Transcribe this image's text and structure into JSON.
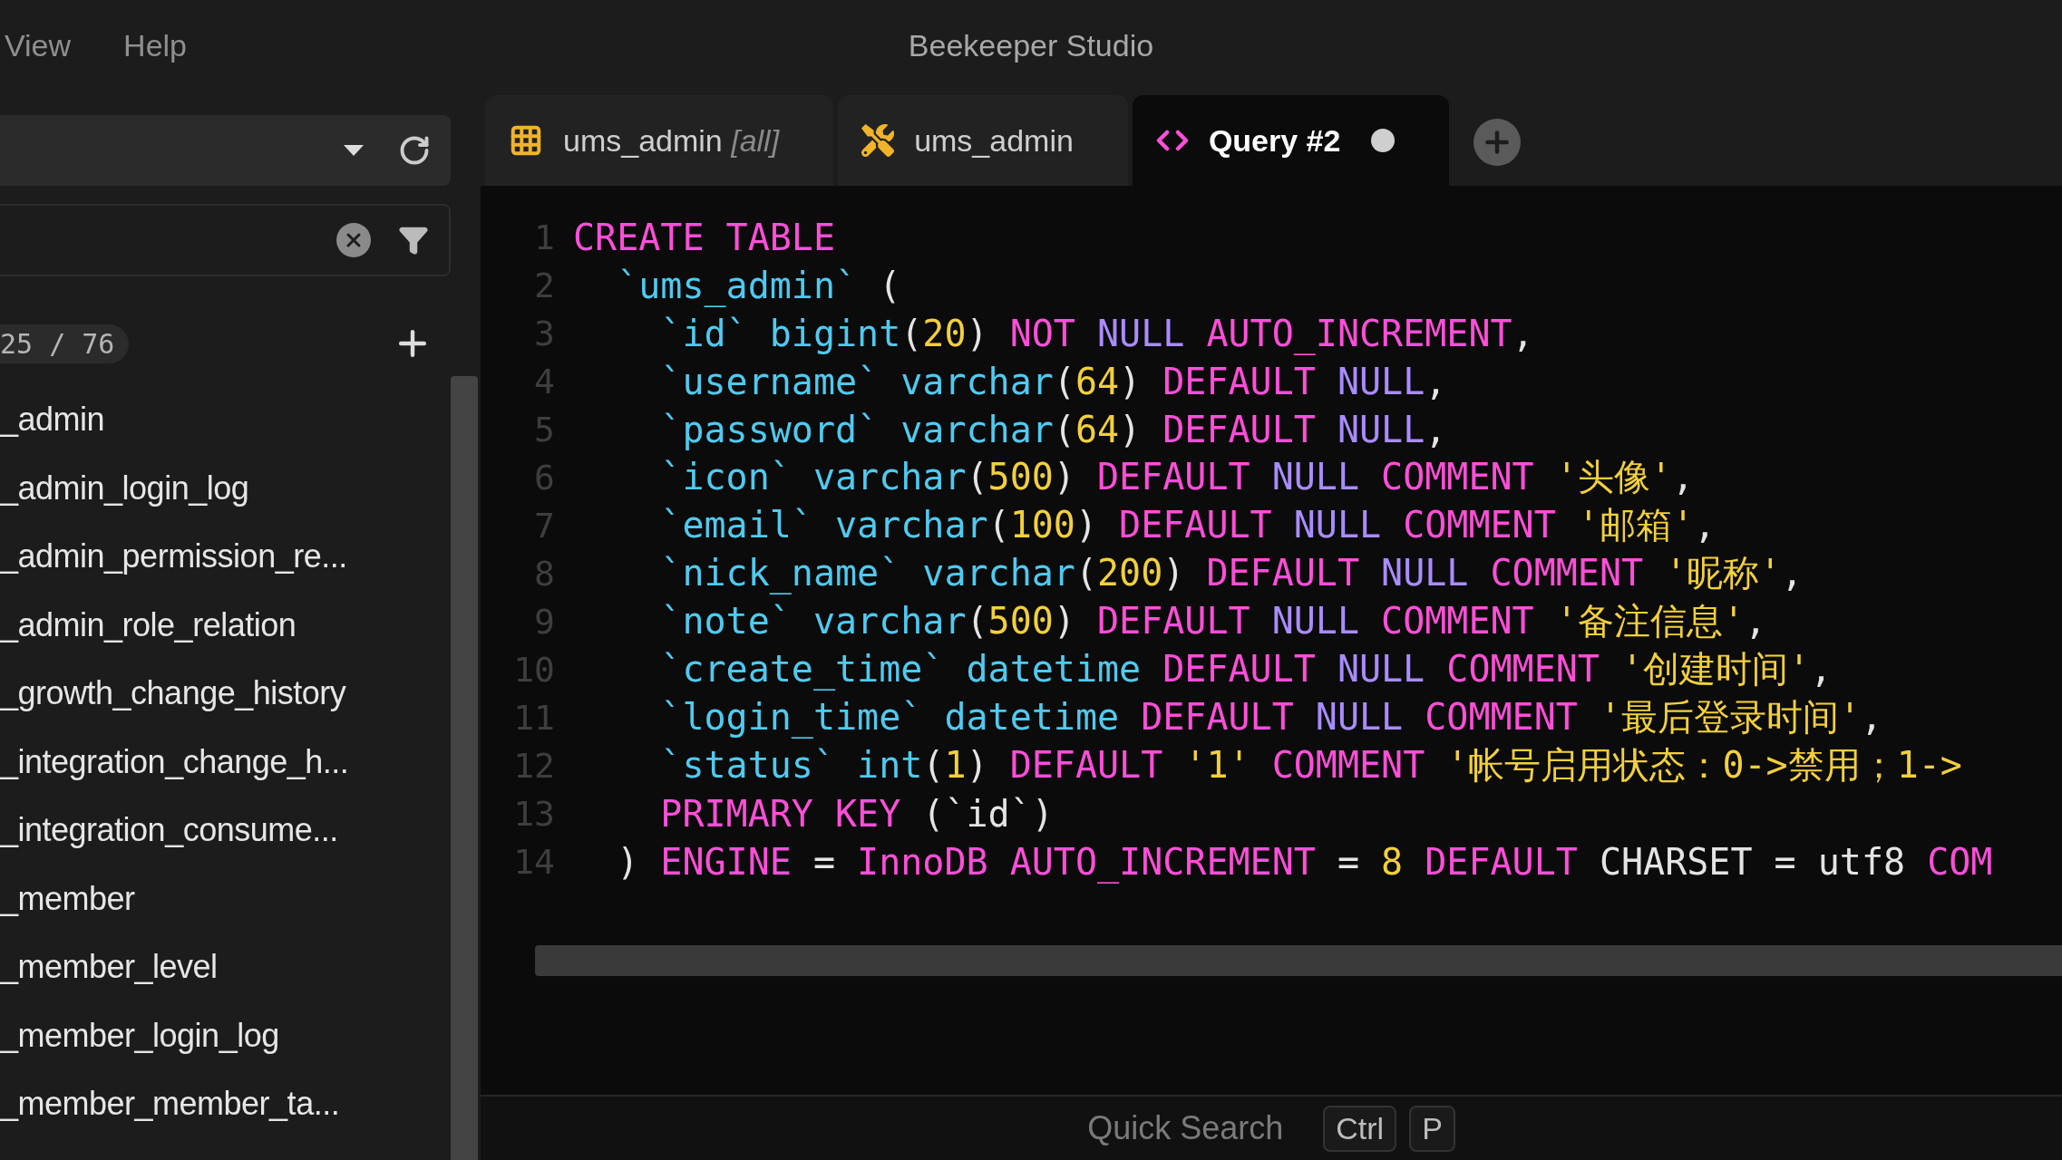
{
  "menu": [
    {
      "label": "View"
    },
    {
      "label": "Help"
    }
  ],
  "window": {
    "title": "Beekeeper Studio"
  },
  "sidebar": {
    "table_count": "25 / 76",
    "tables": [
      "_admin",
      "_admin_login_log",
      "_admin_permission_re...",
      "_admin_role_relation",
      "_growth_change_history",
      "_integration_change_h...",
      "_integration_consume...",
      "_member",
      "_member_level",
      "_member_login_log",
      "_member_member_ta..."
    ]
  },
  "tabs": [
    {
      "kind": "table",
      "label": "ums_admin",
      "suffix": "[all]",
      "selected": false,
      "unsaved": false
    },
    {
      "kind": "structure",
      "label": "ums_admin",
      "selected": false,
      "unsaved": false
    },
    {
      "kind": "query",
      "label": "Query #2",
      "selected": true,
      "unsaved": true
    }
  ],
  "editor": {
    "lines": [
      {
        "number": "1",
        "tokens": [
          {
            "kind": "keyword",
            "text": "CREATE TABLE"
          }
        ]
      },
      {
        "number": "2",
        "tokens": [
          {
            "kind": "ident",
            "text": "  `ums_admin`"
          },
          {
            "kind": "plain",
            "text": " ("
          }
        ]
      },
      {
        "number": "3",
        "tokens": [
          {
            "kind": "ident",
            "text": "    `id` bigint"
          },
          {
            "kind": "plain",
            "text": "("
          },
          {
            "kind": "number",
            "text": "20"
          },
          {
            "kind": "plain",
            "text": ") "
          },
          {
            "kind": "keyword",
            "text": "NOT "
          },
          {
            "kind": "null",
            "text": "NULL "
          },
          {
            "kind": "keyword",
            "text": "AUTO_INCREMENT"
          },
          {
            "kind": "plain",
            "text": ","
          }
        ]
      },
      {
        "number": "4",
        "tokens": [
          {
            "kind": "ident",
            "text": "    `username` varchar"
          },
          {
            "kind": "plain",
            "text": "("
          },
          {
            "kind": "number",
            "text": "64"
          },
          {
            "kind": "plain",
            "text": ") "
          },
          {
            "kind": "keyword",
            "text": "DEFAULT "
          },
          {
            "kind": "null",
            "text": "NULL"
          },
          {
            "kind": "plain",
            "text": ","
          }
        ]
      },
      {
        "number": "5",
        "tokens": [
          {
            "kind": "ident",
            "text": "    `password` varchar"
          },
          {
            "kind": "plain",
            "text": "("
          },
          {
            "kind": "number",
            "text": "64"
          },
          {
            "kind": "plain",
            "text": ") "
          },
          {
            "kind": "keyword",
            "text": "DEFAULT "
          },
          {
            "kind": "null",
            "text": "NULL"
          },
          {
            "kind": "plain",
            "text": ","
          }
        ]
      },
      {
        "number": "6",
        "tokens": [
          {
            "kind": "ident",
            "text": "    `icon` varchar"
          },
          {
            "kind": "plain",
            "text": "("
          },
          {
            "kind": "number",
            "text": "500"
          },
          {
            "kind": "plain",
            "text": ") "
          },
          {
            "kind": "keyword",
            "text": "DEFAULT "
          },
          {
            "kind": "null",
            "text": "NULL "
          },
          {
            "kind": "keyword",
            "text": "COMMENT "
          },
          {
            "kind": "string",
            "text": "'头像'"
          },
          {
            "kind": "plain",
            "text": ","
          }
        ]
      },
      {
        "number": "7",
        "tokens": [
          {
            "kind": "ident",
            "text": "    `email` varchar"
          },
          {
            "kind": "plain",
            "text": "("
          },
          {
            "kind": "number",
            "text": "100"
          },
          {
            "kind": "plain",
            "text": ") "
          },
          {
            "kind": "keyword",
            "text": "DEFAULT "
          },
          {
            "kind": "null",
            "text": "NULL "
          },
          {
            "kind": "keyword",
            "text": "COMMENT "
          },
          {
            "kind": "string",
            "text": "'邮箱'"
          },
          {
            "kind": "plain",
            "text": ","
          }
        ]
      },
      {
        "number": "8",
        "tokens": [
          {
            "kind": "ident",
            "text": "    `nick_name` varchar"
          },
          {
            "kind": "plain",
            "text": "("
          },
          {
            "kind": "number",
            "text": "200"
          },
          {
            "kind": "plain",
            "text": ") "
          },
          {
            "kind": "keyword",
            "text": "DEFAULT "
          },
          {
            "kind": "null",
            "text": "NULL "
          },
          {
            "kind": "keyword",
            "text": "COMMENT "
          },
          {
            "kind": "string",
            "text": "'昵称'"
          },
          {
            "kind": "plain",
            "text": ","
          }
        ]
      },
      {
        "number": "9",
        "tokens": [
          {
            "kind": "ident",
            "text": "    `note` varchar"
          },
          {
            "kind": "plain",
            "text": "("
          },
          {
            "kind": "number",
            "text": "500"
          },
          {
            "kind": "plain",
            "text": ") "
          },
          {
            "kind": "keyword",
            "text": "DEFAULT "
          },
          {
            "kind": "null",
            "text": "NULL "
          },
          {
            "kind": "keyword",
            "text": "COMMENT "
          },
          {
            "kind": "string",
            "text": "'备注信息'"
          },
          {
            "kind": "plain",
            "text": ","
          }
        ]
      },
      {
        "number": "10",
        "tokens": [
          {
            "kind": "ident",
            "text": "    `create_time` datetime "
          },
          {
            "kind": "keyword",
            "text": "DEFAULT "
          },
          {
            "kind": "null",
            "text": "NULL "
          },
          {
            "kind": "keyword",
            "text": "COMMENT "
          },
          {
            "kind": "string",
            "text": "'创建时间'"
          },
          {
            "kind": "plain",
            "text": ","
          }
        ]
      },
      {
        "number": "11",
        "tokens": [
          {
            "kind": "ident",
            "text": "    `login_time` datetime "
          },
          {
            "kind": "keyword",
            "text": "DEFAULT "
          },
          {
            "kind": "null",
            "text": "NULL "
          },
          {
            "kind": "keyword",
            "text": "COMMENT "
          },
          {
            "kind": "string",
            "text": "'最后登录时间'"
          },
          {
            "kind": "plain",
            "text": ","
          }
        ]
      },
      {
        "number": "12",
        "tokens": [
          {
            "kind": "ident",
            "text": "    `status` int"
          },
          {
            "kind": "plain",
            "text": "("
          },
          {
            "kind": "number",
            "text": "1"
          },
          {
            "kind": "plain",
            "text": ") "
          },
          {
            "kind": "keyword",
            "text": "DEFAULT "
          },
          {
            "kind": "string",
            "text": "'1' "
          },
          {
            "kind": "keyword",
            "text": "COMMENT "
          },
          {
            "kind": "string",
            "text": "'帐号启用状态：0->禁用；1->"
          }
        ]
      },
      {
        "number": "13",
        "tokens": [
          {
            "kind": "keyword",
            "text": "    PRIMARY KEY "
          },
          {
            "kind": "plain",
            "text": "(`id`)"
          }
        ]
      },
      {
        "number": "14",
        "tokens": [
          {
            "kind": "plain",
            "text": "  ) "
          },
          {
            "kind": "keyword",
            "text": "ENGINE "
          },
          {
            "kind": "plain",
            "text": "= "
          },
          {
            "kind": "keyword",
            "text": "InnoDB AUTO_INCREMENT "
          },
          {
            "kind": "plain",
            "text": "= "
          },
          {
            "kind": "number",
            "text": "8 "
          },
          {
            "kind": "keyword",
            "text": "DEFAULT "
          },
          {
            "kind": "plain",
            "text": "CHARSET = utf8 "
          },
          {
            "kind": "keyword",
            "text": "COM"
          }
        ]
      }
    ]
  },
  "status_bar": {
    "quick_search": "Quick Search",
    "keys": [
      "Ctrl",
      "P"
    ]
  }
}
